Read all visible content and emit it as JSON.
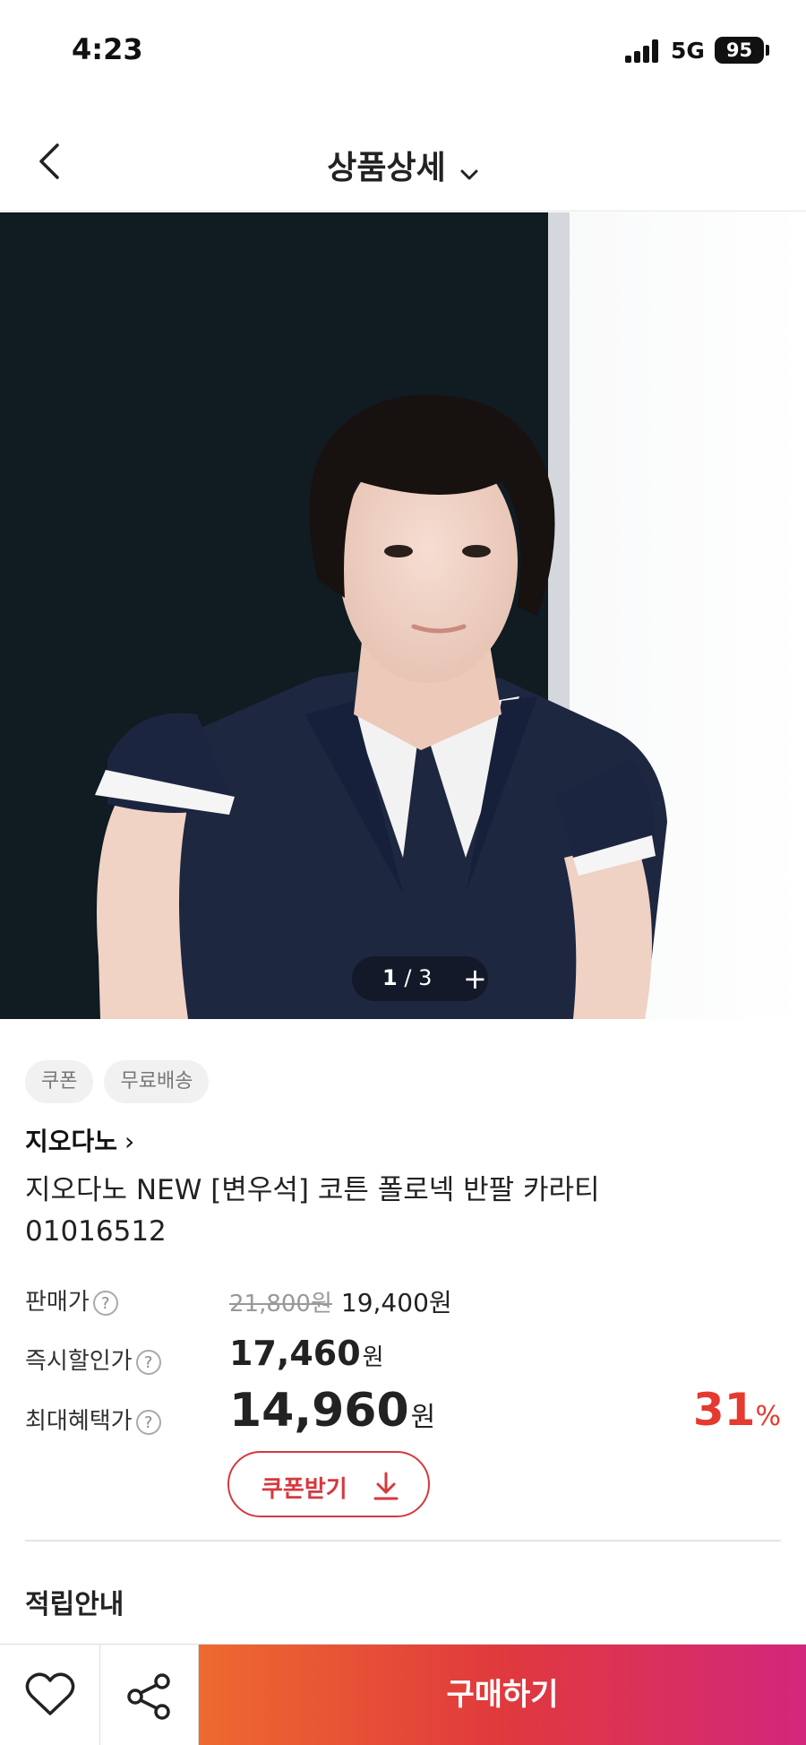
{
  "status_bar": {
    "time": "4:23",
    "network": "5G",
    "battery": "95"
  },
  "header": {
    "title": "상품상세",
    "back_icon": "chevron-left-icon",
    "dropdown_icon": "chevron-down-icon"
  },
  "hero": {
    "pager_current": "1",
    "pager_separator": "/",
    "pager_total": "3",
    "pager_plus": "+"
  },
  "chips": [
    "쿠폰",
    "무료배송"
  ],
  "brand": {
    "name": "지오다노",
    "arrow": "›"
  },
  "product": {
    "name_line1": "지오다노 NEW [변우석] 코튼 폴로넥 반팔 카라티",
    "name_line2": "01016512"
  },
  "prices": {
    "sale_label": "판매가",
    "original": "21,800원",
    "sale": "19,400원",
    "instant_label": "즉시할인가",
    "instant_num": "17,460",
    "max_label": "최대혜택가",
    "max_num": "14,960",
    "won": "원",
    "discount_num": "31",
    "discount_pct": "%",
    "help_glyph": "?"
  },
  "coupon": {
    "label": "쿠폰받기"
  },
  "section": {
    "title": "적립안내"
  },
  "bottom_bar": {
    "buy_label": "구매하기"
  },
  "colors": {
    "accent_red": "#e53a2f",
    "coupon_red": "#d6383f",
    "buy_gradient_start": "#ee6a2f",
    "buy_gradient_end": "#d3277b"
  }
}
